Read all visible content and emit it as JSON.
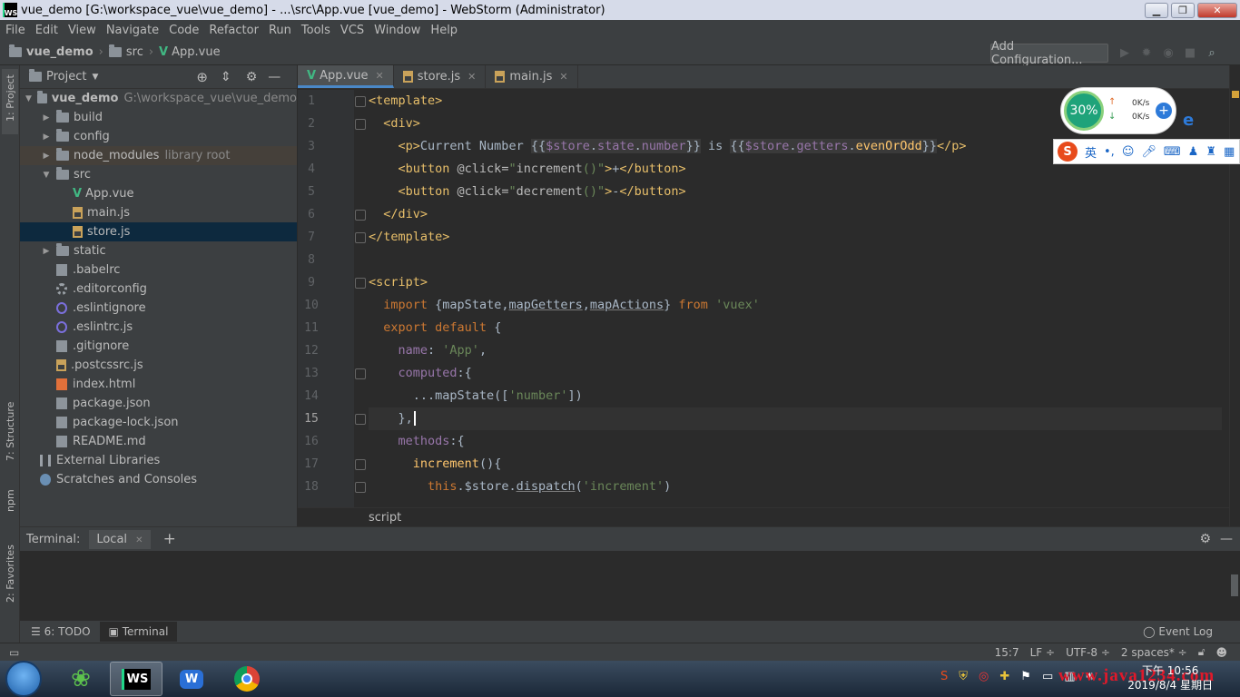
{
  "window": {
    "title": "vue_demo [G:\\workspace_vue\\vue_demo] - ...\\src\\App.vue [vue_demo] - WebStorm (Administrator)",
    "min": "▁",
    "max": "❐",
    "close": "✕",
    "app_icon": "WS"
  },
  "menu": [
    "File",
    "Edit",
    "View",
    "Navigate",
    "Code",
    "Refactor",
    "Run",
    "Tools",
    "VCS",
    "Window",
    "Help"
  ],
  "breadcrumb": {
    "project": "vue_demo",
    "folder": "src",
    "file": "App.vue"
  },
  "toolbar": {
    "add_config": "Add Configuration..."
  },
  "left_strip": {
    "project": "1: Project",
    "structure": "7: Structure",
    "npm": "npm",
    "favorites": "2: Favorites"
  },
  "project_panel": {
    "title": "Project",
    "tree": [
      {
        "label": "vue_demo",
        "hint": "G:\\workspace_vue\\vue_demo",
        "depth": 0,
        "arrow": "▼",
        "icon": "folder",
        "bold": true
      },
      {
        "label": "build",
        "hint": "",
        "depth": 1,
        "arrow": "▶",
        "icon": "folder"
      },
      {
        "label": "config",
        "hint": "",
        "depth": 1,
        "arrow": "▶",
        "icon": "folder"
      },
      {
        "label": "node_modules",
        "hint": "library root",
        "depth": 1,
        "arrow": "▶",
        "icon": "folder",
        "hl": true
      },
      {
        "label": "src",
        "hint": "",
        "depth": 1,
        "arrow": "▼",
        "icon": "folder"
      },
      {
        "label": "App.vue",
        "hint": "",
        "depth": 2,
        "arrow": "",
        "icon": "vue"
      },
      {
        "label": "main.js",
        "hint": "",
        "depth": 2,
        "arrow": "",
        "icon": "js"
      },
      {
        "label": "store.js",
        "hint": "",
        "depth": 2,
        "arrow": "",
        "icon": "js",
        "selected": true
      },
      {
        "label": "static",
        "hint": "",
        "depth": 1,
        "arrow": "▶",
        "icon": "folder"
      },
      {
        "label": ".babelrc",
        "hint": "",
        "depth": 1,
        "arrow": "",
        "icon": "file"
      },
      {
        "label": ".editorconfig",
        "hint": "",
        "depth": 1,
        "arrow": "",
        "icon": "gear"
      },
      {
        "label": ".eslintignore",
        "hint": "",
        "depth": 1,
        "arrow": "",
        "icon": "eslint"
      },
      {
        "label": ".eslintrc.js",
        "hint": "",
        "depth": 1,
        "arrow": "",
        "icon": "eslint"
      },
      {
        "label": ".gitignore",
        "hint": "",
        "depth": 1,
        "arrow": "",
        "icon": "file"
      },
      {
        "label": ".postcssrc.js",
        "hint": "",
        "depth": 1,
        "arrow": "",
        "icon": "js"
      },
      {
        "label": "index.html",
        "hint": "",
        "depth": 1,
        "arrow": "",
        "icon": "html"
      },
      {
        "label": "package.json",
        "hint": "",
        "depth": 1,
        "arrow": "",
        "icon": "file"
      },
      {
        "label": "package-lock.json",
        "hint": "",
        "depth": 1,
        "arrow": "",
        "icon": "file"
      },
      {
        "label": "README.md",
        "hint": "",
        "depth": 1,
        "arrow": "",
        "icon": "file"
      },
      {
        "label": "External Libraries",
        "hint": "",
        "depth": 0,
        "arrow": "",
        "icon": "lib"
      },
      {
        "label": "Scratches and Consoles",
        "hint": "",
        "depth": 0,
        "arrow": "",
        "icon": "scr"
      }
    ]
  },
  "editor": {
    "tabs": [
      {
        "label": "App.vue",
        "icon": "vue",
        "active": true
      },
      {
        "label": "store.js",
        "icon": "js",
        "active": false
      },
      {
        "label": "main.js",
        "icon": "js",
        "active": false
      }
    ],
    "line_numbers": [
      "1",
      "2",
      "3",
      "4",
      "5",
      "6",
      "7",
      "8",
      "9",
      "10",
      "11",
      "12",
      "13",
      "14",
      "15",
      "16",
      "17",
      "18"
    ],
    "current_line": "15",
    "breadcrumb": "script"
  },
  "overlay": {
    "percent": "30%",
    "up": "0K/s",
    "down": "0K/s"
  },
  "ime": {
    "logo": "S",
    "lang": "英"
  },
  "terminal": {
    "label": "Terminal:",
    "tab": "Local",
    "add": "+"
  },
  "bottom_tabs": {
    "todo": "6: TODO",
    "terminal": "Terminal",
    "event_log": "Event Log"
  },
  "status": {
    "position": "15:7",
    "line_sep": "LF ÷",
    "encoding": "UTF-8 ÷",
    "indent": "2 spaces* ÷"
  },
  "taskbar": {
    "time": "下午 10:56",
    "date": "2019/8/4 星期日",
    "watermark": "www.java1234.com"
  },
  "colors": {
    "accent": "#4a88c7",
    "vue": "#41b883",
    "selection": "#0d293e"
  }
}
